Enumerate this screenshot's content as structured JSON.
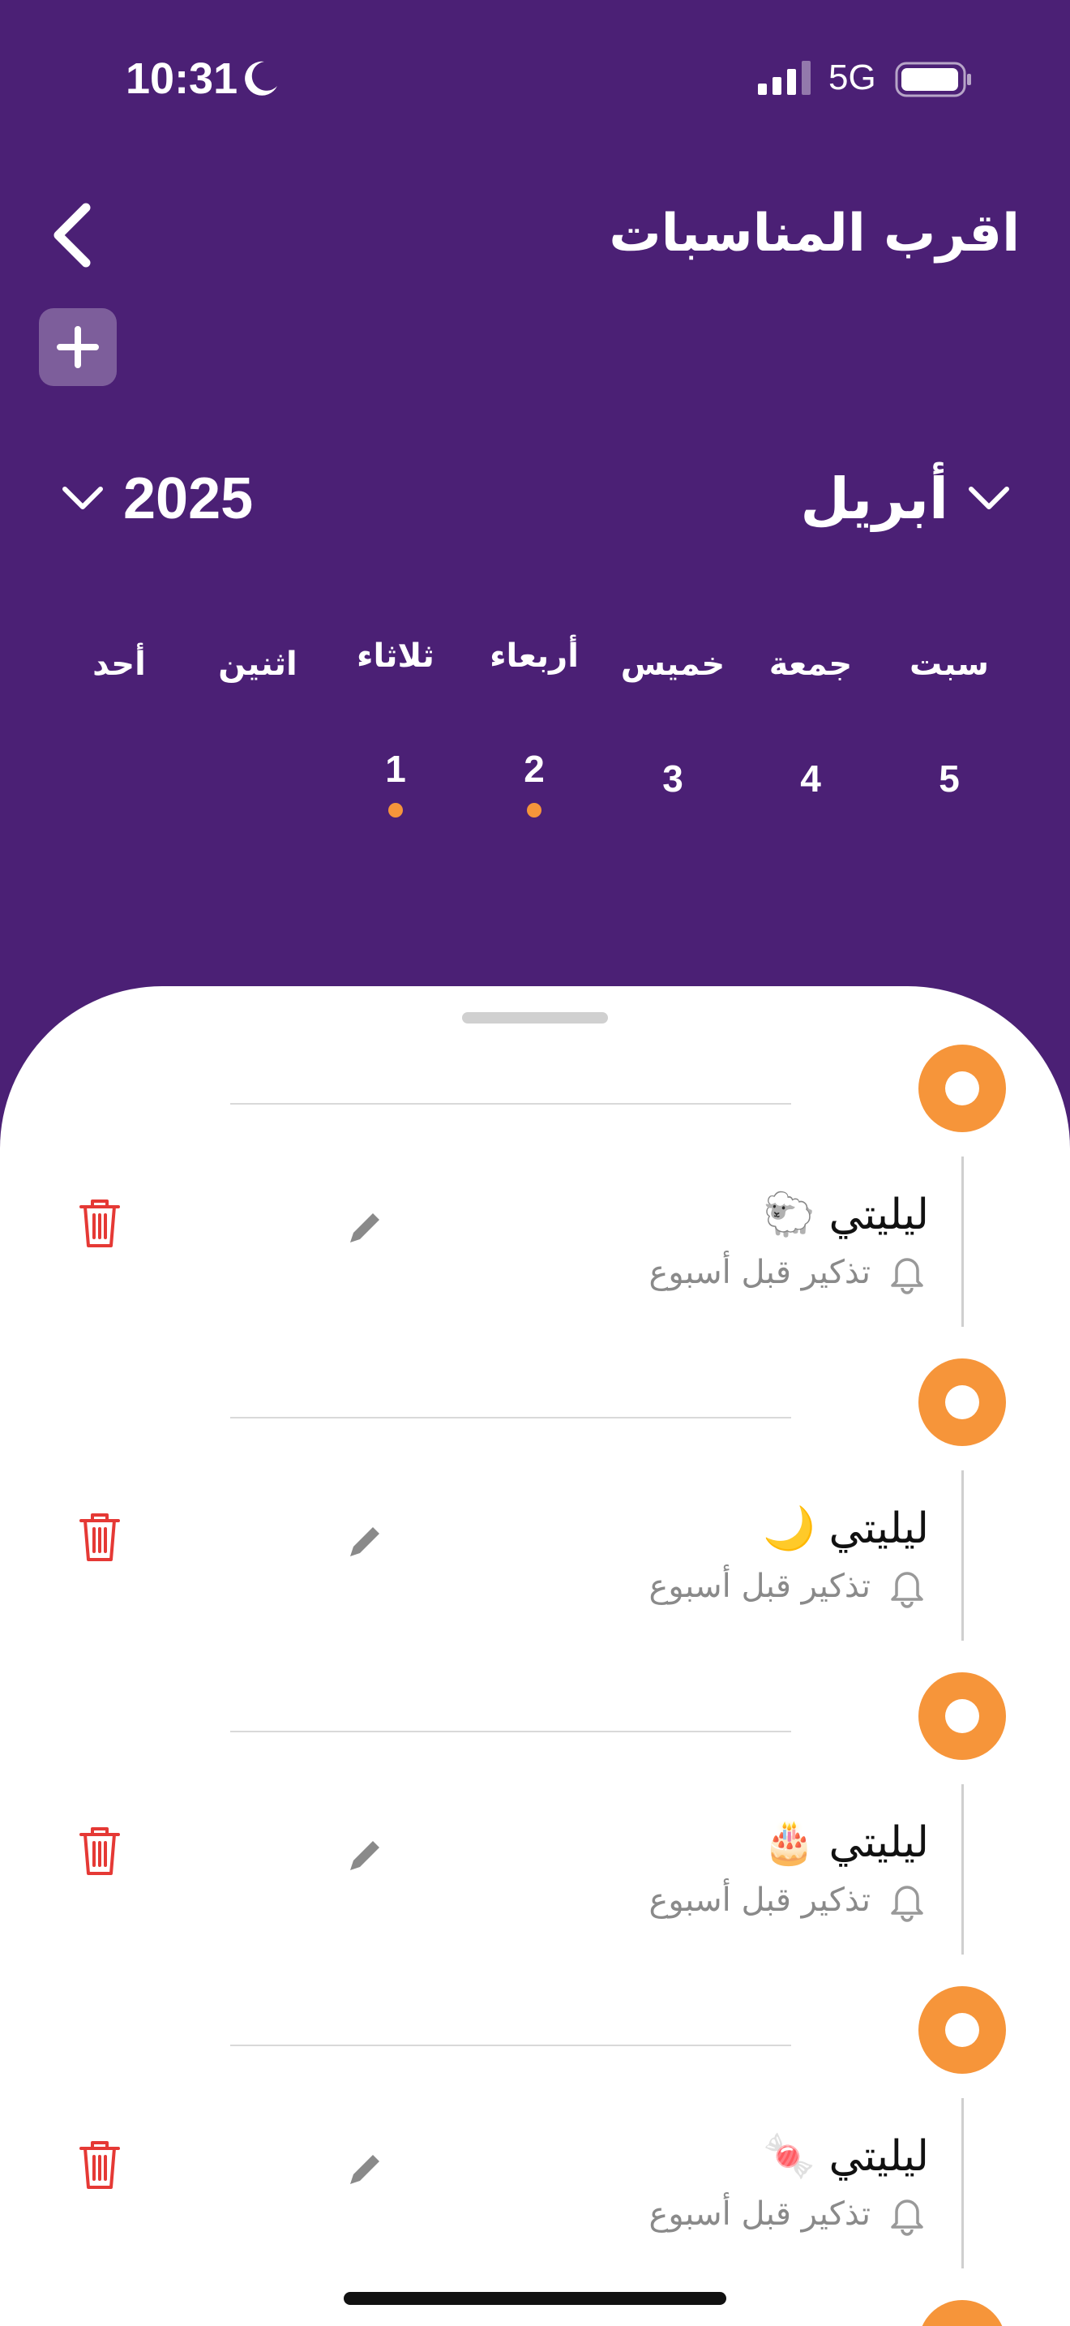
{
  "status_bar": {
    "time": "10:31",
    "network": "5G"
  },
  "header": {
    "title": "اقرب المناسبات"
  },
  "calendar": {
    "month": "أبريل",
    "year": "2025",
    "weekdays": [
      "سبت",
      "جمعة",
      "خميس",
      "أربعاء",
      "ثلاثاء",
      "اثنين",
      "أحد"
    ],
    "days": [
      {
        "num": "5",
        "has_event": false
      },
      {
        "num": "4",
        "has_event": false
      },
      {
        "num": "3",
        "has_event": false
      },
      {
        "num": "2",
        "has_event": true
      },
      {
        "num": "1",
        "has_event": true
      }
    ]
  },
  "events": [
    {
      "name": "ليليتي 🐑",
      "reminder": "تذكير قبل أسبوع"
    },
    {
      "name": "ليليتي 🌙",
      "reminder": "تذكير قبل أسبوع"
    },
    {
      "name": "ليليتي 🎂",
      "reminder": "تذكير قبل أسبوع"
    },
    {
      "name": "ليليتي 🍬",
      "reminder": "تذكير قبل أسبوع"
    }
  ],
  "colors": {
    "header_bg": "#4b2075",
    "accent": "#f6953a",
    "delete": "#e53935"
  }
}
